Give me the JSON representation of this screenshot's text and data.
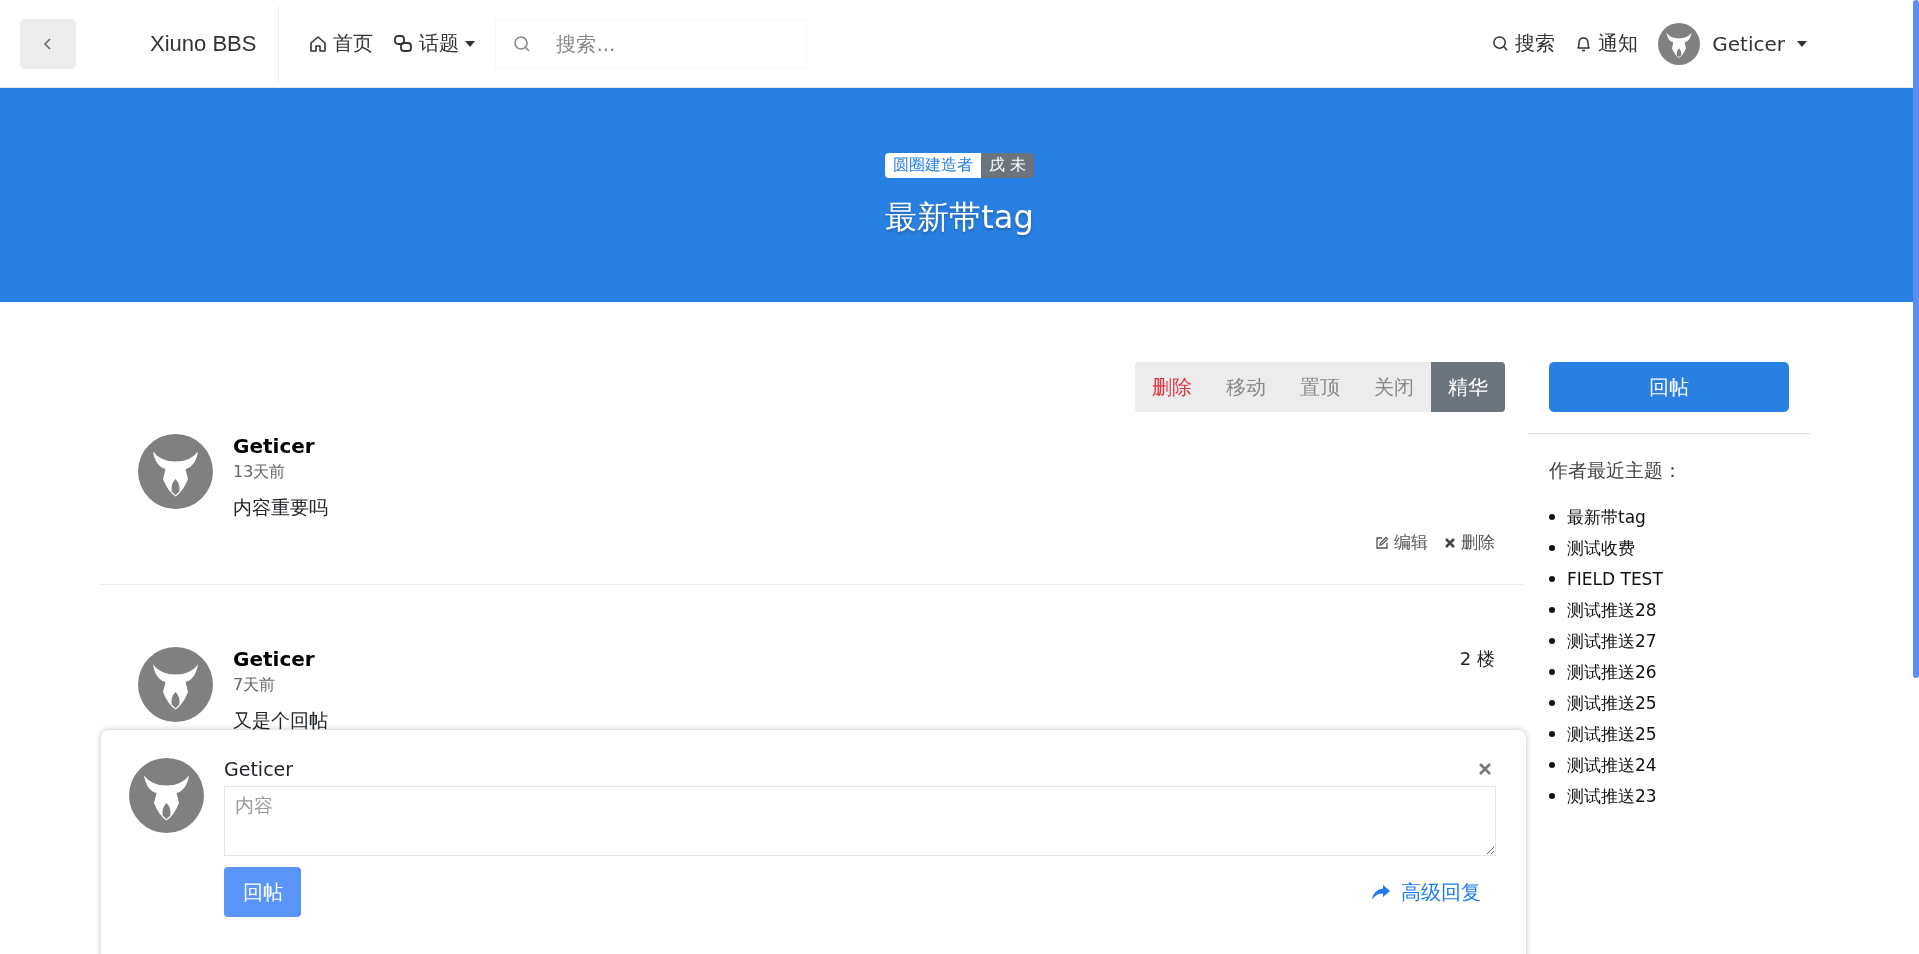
{
  "header": {
    "logo": "Xiuno BBS",
    "nav": [
      {
        "label": "首页",
        "kind": "home",
        "dropdown": false
      },
      {
        "label": "话题",
        "kind": "topics",
        "dropdown": true
      }
    ],
    "search": {
      "placeholder": "搜索..."
    },
    "actions": [
      {
        "label": "搜索",
        "kind": "search"
      },
      {
        "label": "通知",
        "kind": "bell"
      }
    ],
    "user": {
      "name": "Geticer",
      "dropdown": true
    }
  },
  "banner": {
    "tags": [
      {
        "label": "圆圈建造者",
        "kind": "light"
      },
      {
        "label": "戌 未",
        "kind": "dark"
      }
    ],
    "title": "最新带tag"
  },
  "mod_actions": [
    {
      "label": "删除",
      "kind": "danger"
    },
    {
      "label": "移动",
      "kind": "normal"
    },
    {
      "label": "置顶",
      "kind": "normal"
    },
    {
      "label": "关闭",
      "kind": "normal"
    },
    {
      "label": "精华",
      "kind": "active"
    }
  ],
  "posts": [
    {
      "author": "Geticer",
      "time": "13天前",
      "content": "内容重要吗",
      "actions": [
        {
          "label": "编辑",
          "kind": "edit"
        },
        {
          "label": "删除",
          "kind": "delete"
        }
      ]
    },
    {
      "author": "Geticer",
      "time": "7天前",
      "content": "又是个回帖",
      "floor": "2 楼"
    }
  ],
  "sidebar": {
    "reply_button": "回帖",
    "recent_title": "作者最近主题：",
    "recent_topics": [
      "最新带tag",
      "测试收费",
      "FIELD TEST",
      "测试推送28",
      "测试推送27",
      "测试推送26",
      "测试推送25",
      "测试推送25",
      "测试推送24",
      "测试推送23"
    ]
  },
  "reply_box": {
    "author": "Geticer",
    "placeholder": "内容",
    "submit": "回帖",
    "advanced": "高级回复"
  }
}
